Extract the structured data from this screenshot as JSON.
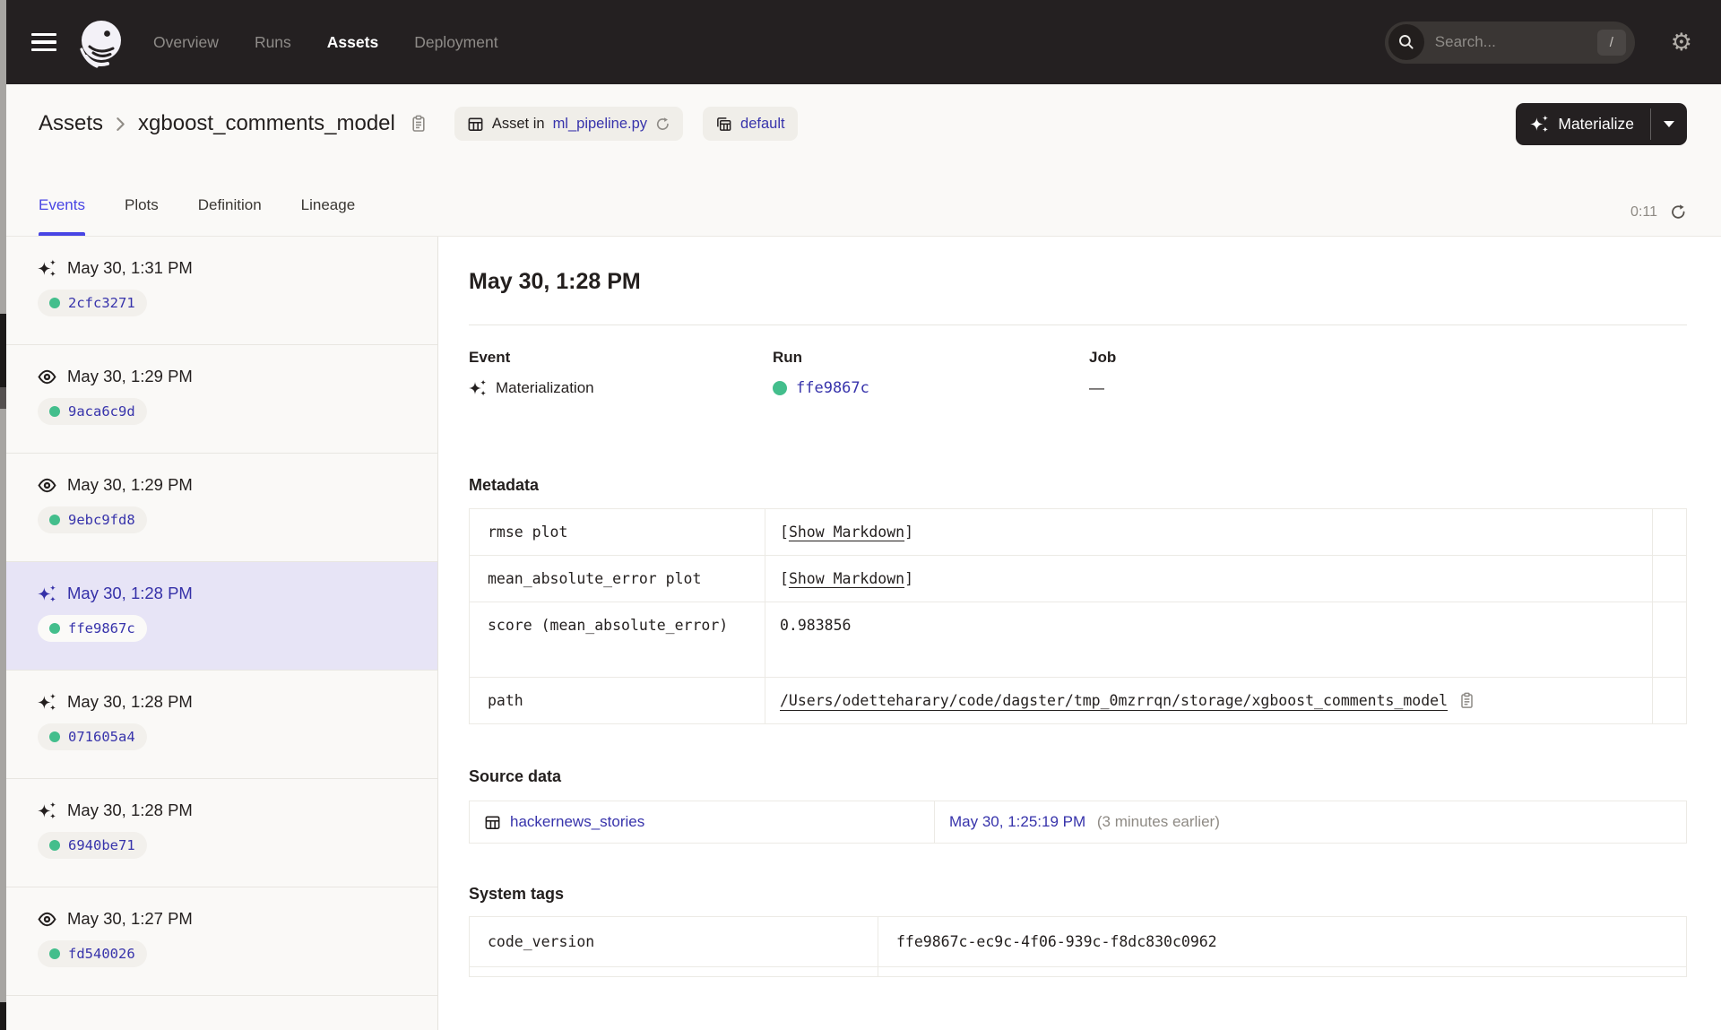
{
  "nav": {
    "items": [
      {
        "label": "Overview"
      },
      {
        "label": "Runs"
      },
      {
        "label": "Assets"
      },
      {
        "label": "Deployment"
      }
    ],
    "search_placeholder": "Search...",
    "search_shortcut": "/"
  },
  "breadcrumb": {
    "root": "Assets",
    "title": "xgboost_comments_model",
    "asset_in_prefix": "Asset in",
    "asset_in_file": "ml_pipeline.py",
    "repo_badge": "default"
  },
  "materialize": {
    "label": "Materialize"
  },
  "tabs": {
    "items": [
      "Events",
      "Plots",
      "Definition",
      "Lineage"
    ],
    "active": "Events",
    "timer": "0:11"
  },
  "sidebar": {
    "items": [
      {
        "type": "materialization",
        "time": "May 30, 1:31 PM",
        "run_id": "2cfc3271"
      },
      {
        "type": "observation",
        "time": "May 30, 1:29 PM",
        "run_id": "9aca6c9d"
      },
      {
        "type": "observation",
        "time": "May 30, 1:29 PM",
        "run_id": "9ebc9fd8"
      },
      {
        "type": "materialization",
        "time": "May 30, 1:28 PM",
        "run_id": "ffe9867c"
      },
      {
        "type": "materialization",
        "time": "May 30, 1:28 PM",
        "run_id": "071605a4"
      },
      {
        "type": "materialization",
        "time": "May 30, 1:28 PM",
        "run_id": "6940be71"
      },
      {
        "type": "observation",
        "time": "May 30, 1:27 PM",
        "run_id": "fd540026"
      }
    ]
  },
  "detail": {
    "title": "May 30, 1:28 PM",
    "event_label": "Event",
    "event_value": "Materialization",
    "run_label": "Run",
    "run_value": "ffe9867c",
    "job_label": "Job",
    "job_value": "—",
    "metadata": {
      "heading": "Metadata",
      "rows": [
        {
          "key": "rmse plot",
          "bracket_open": "[",
          "link": "Show Markdown",
          "bracket_close": "]"
        },
        {
          "key": "mean_absolute_error plot",
          "bracket_open": "[",
          "link": "Show Markdown",
          "bracket_close": "]"
        },
        {
          "key": "score (mean_absolute_error)",
          "value": "0.983856"
        },
        {
          "key": "path",
          "value": "/Users/odetteharary/code/dagster/tmp_0mzrrqn/storage/xgboost_comments_model"
        }
      ]
    },
    "source": {
      "heading": "Source data",
      "asset": "hackernews_stories",
      "timestamp": "May 30, 1:25:19 PM",
      "relative": "(3 minutes earlier)"
    },
    "system_tags": {
      "heading": "System tags",
      "rows": [
        {
          "key": "code_version",
          "value": "ffe9867c-ec9c-4f06-939c-f8dc830c0962"
        }
      ]
    }
  },
  "colors": {
    "nav_bg": "#242021",
    "accent": "#4845E4",
    "link": "#3733AB",
    "success_green": "#43BE8C",
    "selected_bg": "#E7E4F6",
    "page_bg": "#FAF9F7"
  }
}
